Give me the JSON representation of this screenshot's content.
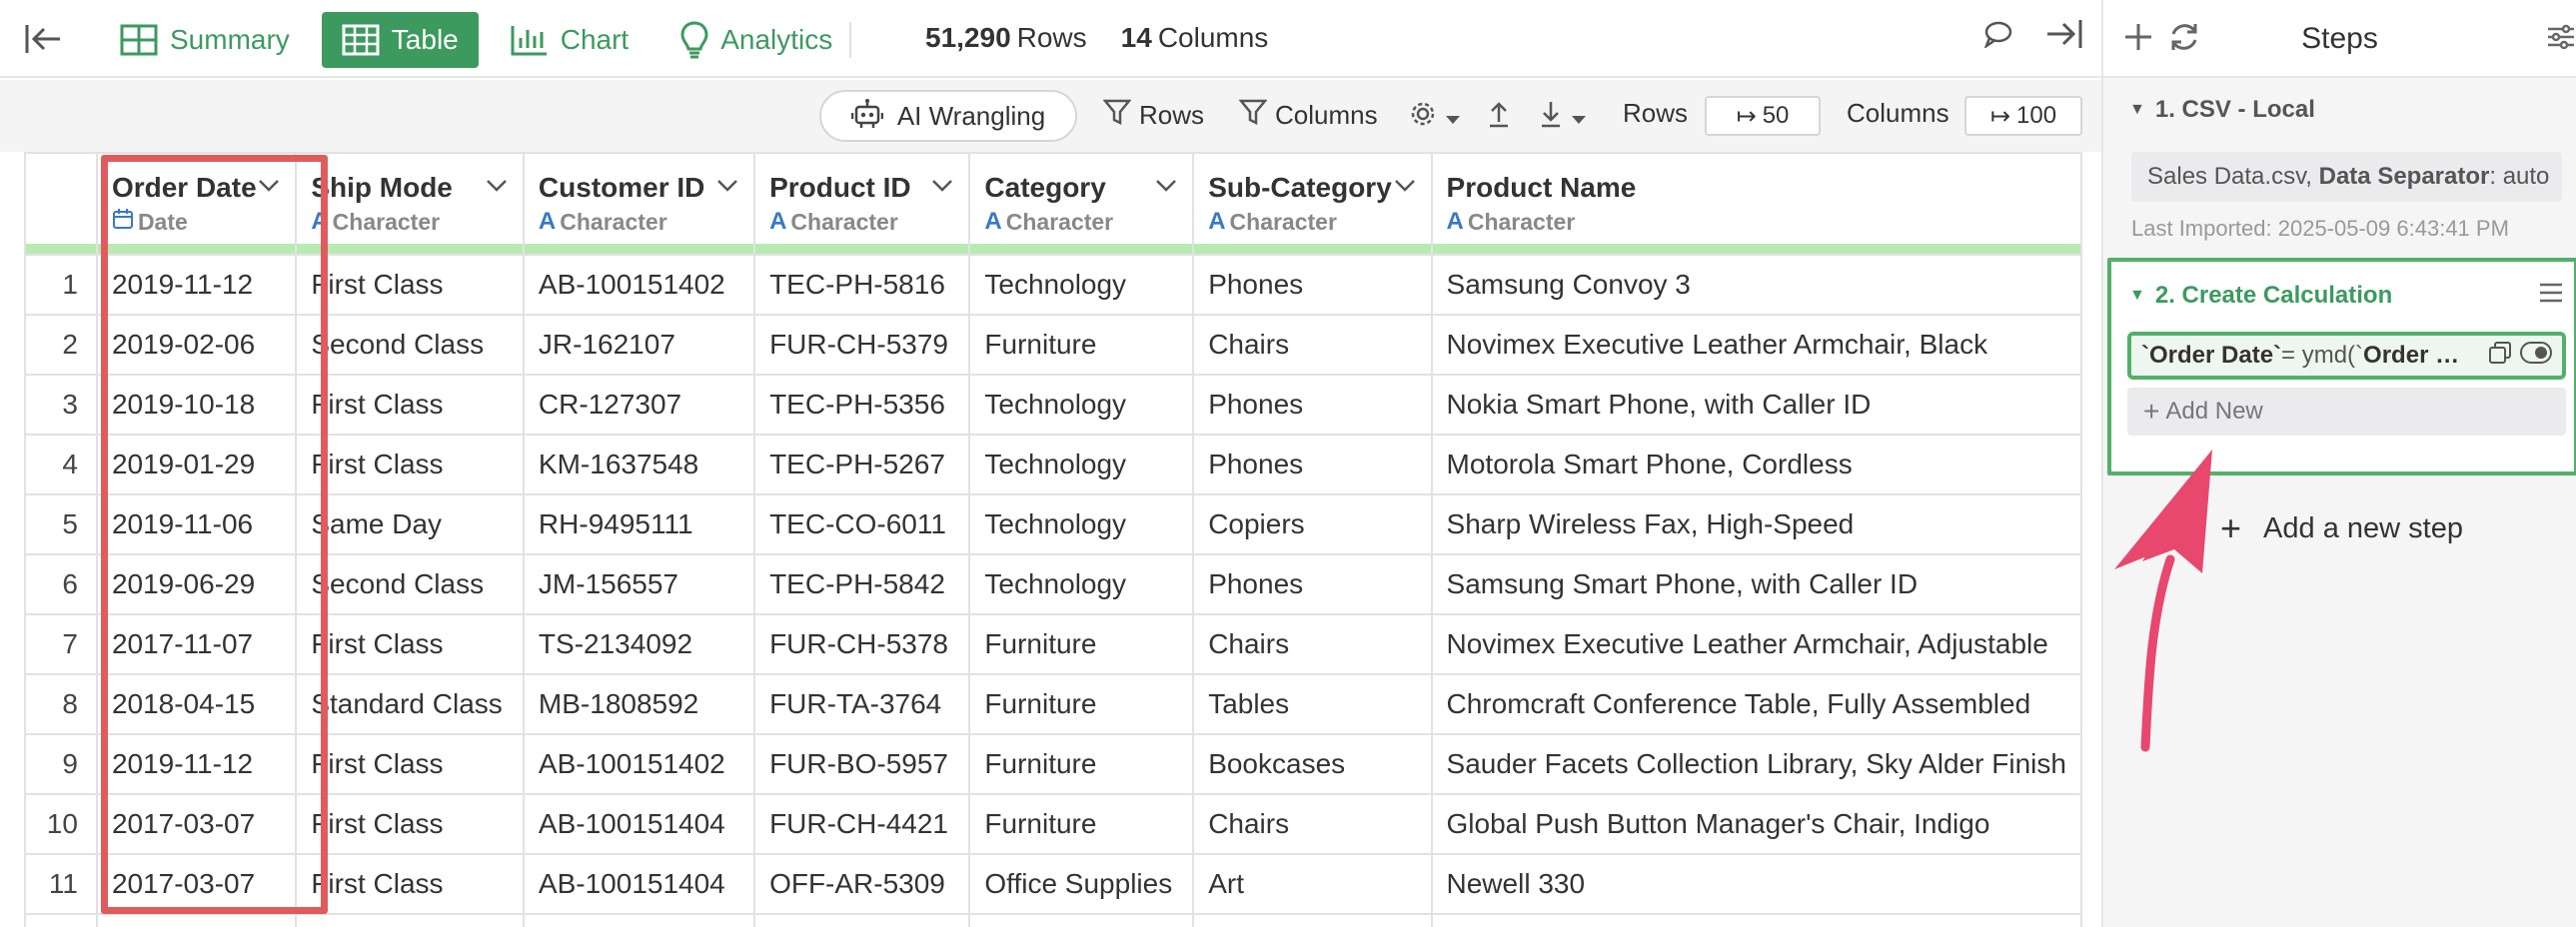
{
  "tabs": [
    {
      "label": "Summary",
      "icon": "summary-grid-icon"
    },
    {
      "label": "Table",
      "icon": "table-icon"
    },
    {
      "label": "Chart",
      "icon": "bar-chart-icon"
    },
    {
      "label": "Analytics",
      "icon": "lightbulb-icon"
    }
  ],
  "active_tab": "Table",
  "counts": {
    "rows_value": "51,290",
    "rows_label": "Rows",
    "cols_value": "14",
    "cols_label": "Columns"
  },
  "toolbar": {
    "ai_label": "AI Wrangling",
    "rows_filter": "Rows",
    "columns_filter": "Columns",
    "rows_label": "Rows",
    "rows_value": "50",
    "columns_label": "Columns",
    "columns_value": "100"
  },
  "columns": [
    {
      "name": "Order Date",
      "type": "Date"
    },
    {
      "name": "Ship Mode",
      "type": "Character"
    },
    {
      "name": "Customer ID",
      "type": "Character"
    },
    {
      "name": "Product ID",
      "type": "Character"
    },
    {
      "name": "Category",
      "type": "Character"
    },
    {
      "name": "Sub-Category",
      "type": "Character"
    },
    {
      "name": "Product Name",
      "type": "Character"
    }
  ],
  "rows": [
    [
      "1",
      "2019-11-12",
      "First Class",
      "AB-100151402",
      "TEC-PH-5816",
      "Technology",
      "Phones",
      "Samsung Convoy 3"
    ],
    [
      "2",
      "2019-02-06",
      "Second Class",
      "JR-162107",
      "FUR-CH-5379",
      "Furniture",
      "Chairs",
      "Novimex Executive Leather Armchair, Black"
    ],
    [
      "3",
      "2019-10-18",
      "First Class",
      "CR-127307",
      "TEC-PH-5356",
      "Technology",
      "Phones",
      "Nokia Smart Phone, with Caller ID"
    ],
    [
      "4",
      "2019-01-29",
      "First Class",
      "KM-1637548",
      "TEC-PH-5267",
      "Technology",
      "Phones",
      "Motorola Smart Phone, Cordless"
    ],
    [
      "5",
      "2019-11-06",
      "Same Day",
      "RH-9495111",
      "TEC-CO-6011",
      "Technology",
      "Copiers",
      "Sharp Wireless Fax, High-Speed"
    ],
    [
      "6",
      "2019-06-29",
      "Second Class",
      "JM-156557",
      "TEC-PH-5842",
      "Technology",
      "Phones",
      "Samsung Smart Phone, with Caller ID"
    ],
    [
      "7",
      "2017-11-07",
      "First Class",
      "TS-2134092",
      "FUR-CH-5378",
      "Furniture",
      "Chairs",
      "Novimex Executive Leather Armchair, Adjustable"
    ],
    [
      "8",
      "2018-04-15",
      "Standard Class",
      "MB-1808592",
      "FUR-TA-3764",
      "Furniture",
      "Tables",
      "Chromcraft Conference Table, Fully Assembled"
    ],
    [
      "9",
      "2019-11-12",
      "First Class",
      "AB-100151402",
      "FUR-BO-5957",
      "Furniture",
      "Bookcases",
      "Sauder Facets Collection Library, Sky Alder Finish"
    ],
    [
      "10",
      "2017-03-07",
      "First Class",
      "AB-100151404",
      "FUR-CH-4421",
      "Furniture",
      "Chairs",
      "Global Push Button Manager's Chair, Indigo"
    ],
    [
      "11",
      "2017-03-07",
      "First Class",
      "AB-100151404",
      "OFF-AR-5309",
      "Office Supplies",
      "Art",
      "Newell 330"
    ]
  ],
  "steps_panel": {
    "title": "Steps",
    "step1": {
      "title": "1. CSV - Local",
      "file": "Sales Data.csv,",
      "separator_key": "Data Separator",
      "separator_value": ": auto",
      "imported": "Last Imported: 2025-05-09 6:43:41 PM"
    },
    "step2": {
      "title": "2. Create Calculation",
      "calc_target": "`Order Date`",
      "calc_expr": " = ymd(`",
      "calc_arg": "Order …",
      "add_new": "Add New"
    },
    "add_step": "Add a new step"
  },
  "colors": {
    "accent": "#3c9a5f",
    "highlight": "#e05c5c",
    "arrow": "#e8486e",
    "type_icon": "#3a78c7"
  }
}
